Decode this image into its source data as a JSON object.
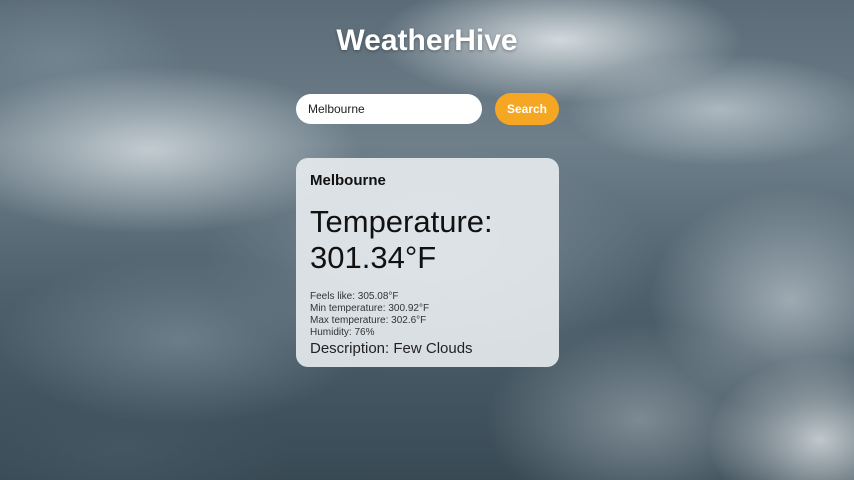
{
  "app": {
    "title": "WeatherHive"
  },
  "search": {
    "value": "Melbourne",
    "button_label": "Search"
  },
  "weather": {
    "city": "Melbourne",
    "temperature_label": "Temperature:",
    "temperature_value": "301.34°F",
    "feels_like": "Feels like: 305.08°F",
    "min_temp": "Min temperature: 300.92°F",
    "max_temp": "Max temperature: 302.6°F",
    "humidity": "Humidity: 76%",
    "description": "Description: Few Clouds"
  },
  "colors": {
    "accent": "#f5a623",
    "card_bg": "#e8ecef"
  }
}
